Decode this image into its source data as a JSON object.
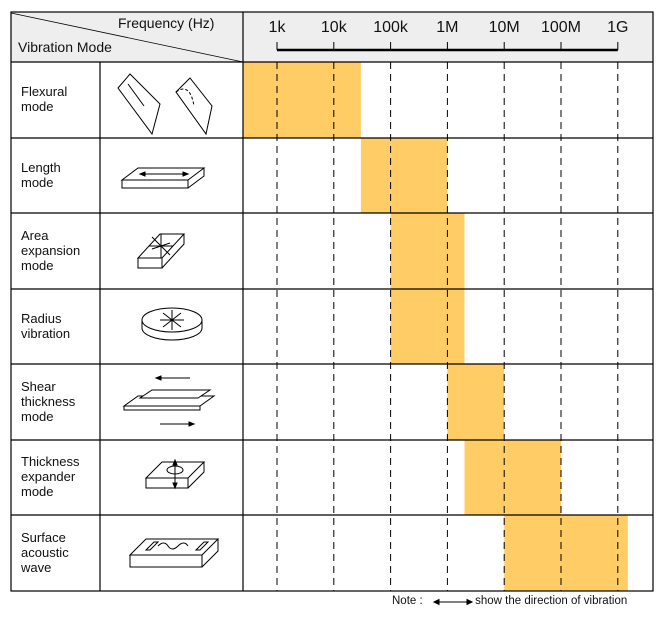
{
  "header": {
    "frequency_label": "Frequency (Hz)",
    "mode_label": "Vibration Mode"
  },
  "note": {
    "prefix": "Note :",
    "text": "show the direction of vibration"
  },
  "colors": {
    "band": "#FFCC66",
    "header_bg": "#EEEEEE",
    "line": "#000000"
  },
  "chart_data": {
    "type": "range-bar",
    "x_scale": "log",
    "x_unit": "Hz",
    "ticks": [
      {
        "label": "1k",
        "value": 1000
      },
      {
        "label": "10k",
        "value": 10000
      },
      {
        "label": "100k",
        "value": 100000
      },
      {
        "label": "1M",
        "value": 1000000
      },
      {
        "label": "10M",
        "value": 10000000
      },
      {
        "label": "100M",
        "value": 100000000
      },
      {
        "label": "1G",
        "value": 1000000000
      }
    ],
    "grid": "dashed vertical at ticks",
    "modes": [
      {
        "name": "Flexural\nmode",
        "icon": "flexural-bar-icon",
        "range": [
          250,
          30000
        ]
      },
      {
        "name": "Length\nmode",
        "icon": "length-plate-icon",
        "range": [
          30000,
          1000000
        ]
      },
      {
        "name": "Area\nexpansion\nmode",
        "icon": "square-plate-radial-icon",
        "range": [
          100000,
          2000000
        ]
      },
      {
        "name": "Radius\nvibration",
        "icon": "disc-radial-icon",
        "range": [
          100000,
          2000000
        ]
      },
      {
        "name": "Shear\nthickness\nmode",
        "icon": "shear-plates-icon",
        "range": [
          1000000,
          10000000
        ]
      },
      {
        "name": "Thickness\nexpander\nmode",
        "icon": "thickness-plate-icon",
        "range": [
          2000000,
          100000000
        ]
      },
      {
        "name": "Surface\nacoustic\nwave",
        "icon": "saw-device-icon",
        "range": [
          10000000,
          1500000000
        ]
      }
    ]
  }
}
